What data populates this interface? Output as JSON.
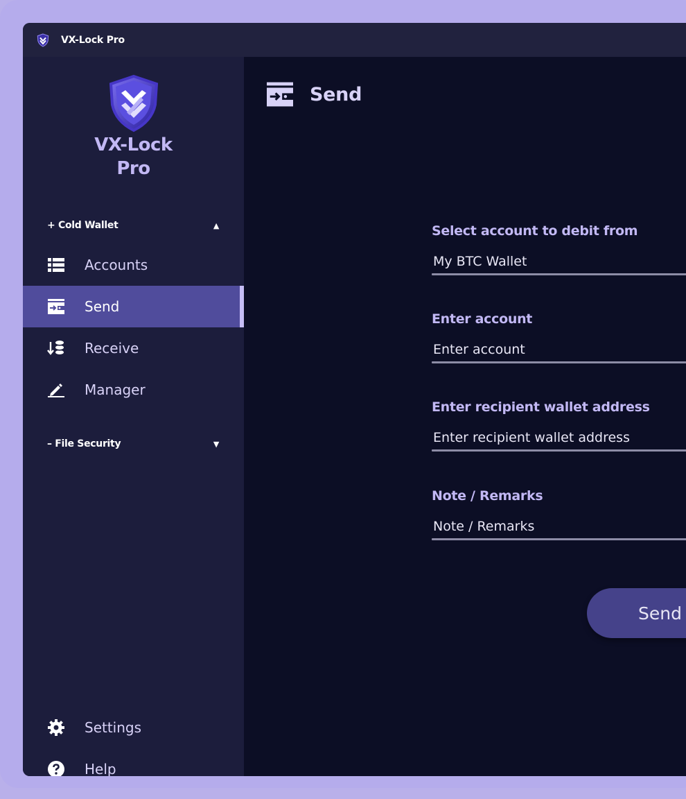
{
  "app": {
    "title": "VX-Lock Pro",
    "brand_line1": "VX-Lock",
    "brand_line2": "Pro"
  },
  "colors": {
    "accent": "#504c9c",
    "label": "#c2b8f4",
    "background": "#0c0e25",
    "sidebar": "#1c1d3c",
    "frame": "#b5acec"
  },
  "sidebar": {
    "cold_wallet_section": {
      "label": "+ Cold Wallet",
      "caret": "▲",
      "caret_icon": "caret-up-icon"
    },
    "items": [
      {
        "label": "Accounts",
        "icon": "list-icon",
        "active": false
      },
      {
        "label": "Send",
        "icon": "send-wallet-icon",
        "active": true
      },
      {
        "label": "Receive",
        "icon": "receive-coins-icon",
        "active": false
      },
      {
        "label": "Manager",
        "icon": "pencil-icon",
        "active": false
      }
    ],
    "file_security_section": {
      "label": "– File Security",
      "caret": "▼",
      "caret_icon": "caret-down-icon"
    },
    "bottom_items": [
      {
        "label": "Settings",
        "icon": "gear-icon"
      },
      {
        "label": "Help",
        "icon": "help-icon"
      }
    ]
  },
  "main": {
    "title": "Send",
    "title_icon": "send-wallet-icon",
    "form": {
      "debit_account": {
        "label": "Select account to debit from",
        "value": "My BTC Wallet"
      },
      "account": {
        "label": "Enter account",
        "placeholder": "Enter account"
      },
      "recipient": {
        "label": "Enter recipient wallet address",
        "placeholder": "Enter recipient wallet address"
      },
      "note": {
        "label": "Note / Remarks",
        "placeholder": "Note / Remarks"
      }
    },
    "send_button": "Send"
  }
}
